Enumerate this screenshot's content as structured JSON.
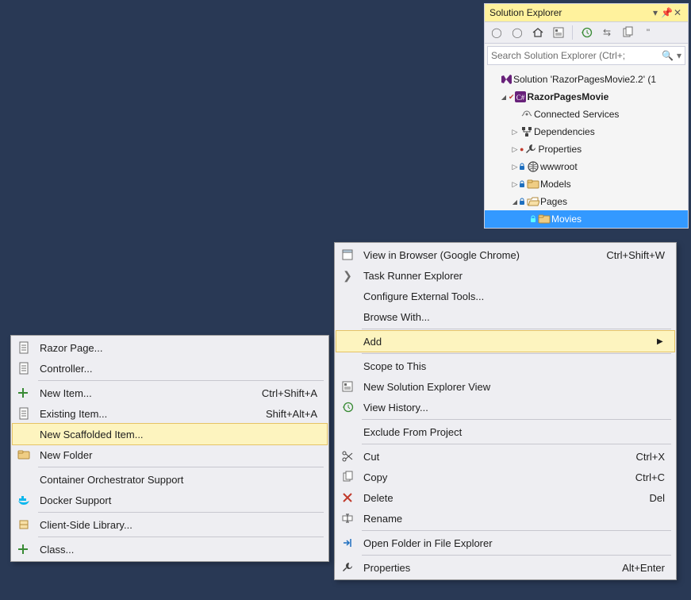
{
  "solutionExplorer": {
    "title": "Solution Explorer",
    "searchPlaceholder": "Search Solution Explorer (Ctrl+;",
    "tree": {
      "solution": "Solution 'RazorPagesMovie2.2' (1",
      "project": "RazorPagesMovie",
      "connectedServices": "Connected Services",
      "dependencies": "Dependencies",
      "properties": "Properties",
      "wwwroot": "wwwroot",
      "models": "Models",
      "pages": "Pages",
      "movies": "Movies"
    }
  },
  "contextMenu": {
    "viewInBrowser": "View in Browser (Google Chrome)",
    "viewInBrowserShortcut": "Ctrl+Shift+W",
    "taskRunner": "Task Runner Explorer",
    "configureTools": "Configure External Tools...",
    "browseWith": "Browse With...",
    "add": "Add",
    "scopeToThis": "Scope to This",
    "newSolutionView": "New Solution Explorer View",
    "viewHistory": "View History...",
    "excludeFromProject": "Exclude From Project",
    "cut": "Cut",
    "cutShortcut": "Ctrl+X",
    "copy": "Copy",
    "copyShortcut": "Ctrl+C",
    "delete": "Delete",
    "deleteShortcut": "Del",
    "rename": "Rename",
    "openInExplorer": "Open Folder in File Explorer",
    "properties": "Properties",
    "propertiesShortcut": "Alt+Enter"
  },
  "addMenu": {
    "razorPage": "Razor Page...",
    "controller": "Controller...",
    "newItem": "New Item...",
    "newItemShortcut": "Ctrl+Shift+A",
    "existingItem": "Existing Item...",
    "existingItemShortcut": "Shift+Alt+A",
    "newScaffoldedItem": "New Scaffolded Item...",
    "newFolder": "New Folder",
    "containerOrchestrator": "Container Orchestrator Support",
    "dockerSupport": "Docker Support",
    "clientSideLibrary": "Client-Side Library...",
    "class": "Class..."
  }
}
